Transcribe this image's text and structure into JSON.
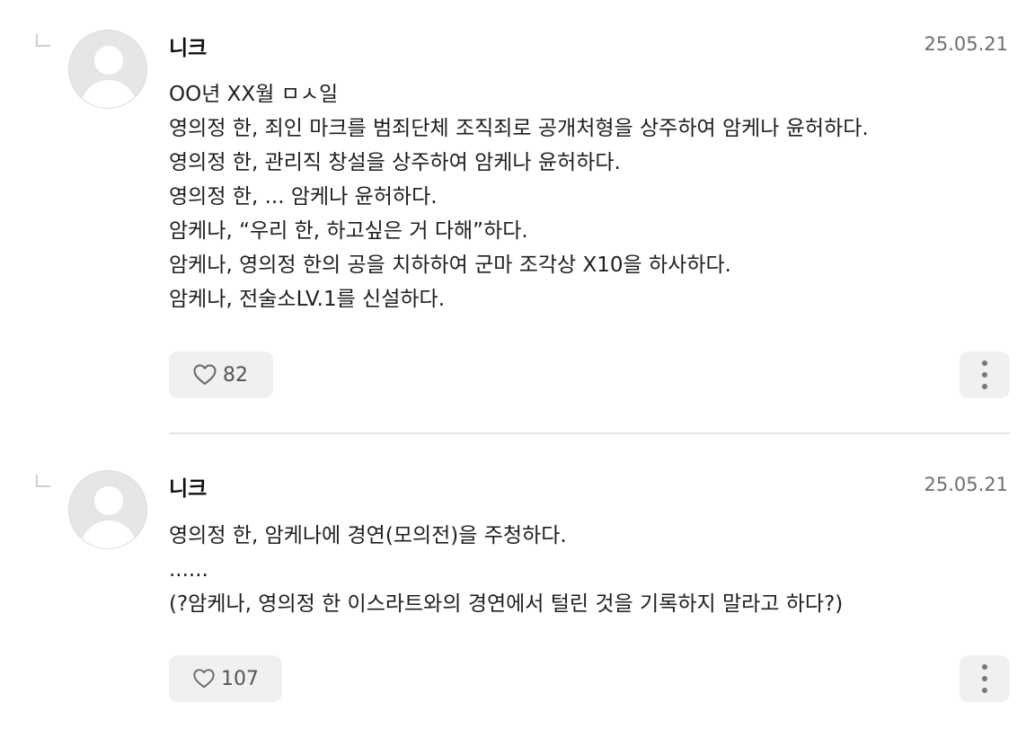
{
  "comments": [
    {
      "nickname": "니크",
      "date": "25.05.21",
      "lines": [
        "OO년 XX월 ㅁㅅ일",
        "영의정 한, 죄인 마크를 범죄단체 조직죄로 공개처형을 상주하여 암케나 윤허하다.",
        "영의정 한, 관리직 창설을 상주하여 암케나 윤허하다.",
        "영의정 한, ... 암케나 윤허하다.",
        "암케나, “우리 한, 하고싶은 거 다해”하다.",
        "암케나, 영의정 한의 공을 치하하여 군마 조각상 X10을 하사하다.",
        "암케나, 전술소LV.1를 신설하다."
      ],
      "likes": "82",
      "like_icon": "heart-outline-icon",
      "more_icon": "vertical-dots-icon"
    },
    {
      "nickname": "니크",
      "date": "25.05.21",
      "lines": [
        "영의정 한, 암케나에 경연(모의전)을 주청하다.",
        "......",
        "(?암케나, 영의정 한 이스라트와의 경연에서 털린 것을 기록하지 말라고 하다?)"
      ],
      "likes": "107",
      "like_icon": "heart-outline-icon",
      "more_icon": "vertical-dots-icon"
    }
  ],
  "colors": {
    "button_bg": "#f0f0f0",
    "date_text": "#6f6f6f",
    "divider": "#e4e4e4"
  }
}
